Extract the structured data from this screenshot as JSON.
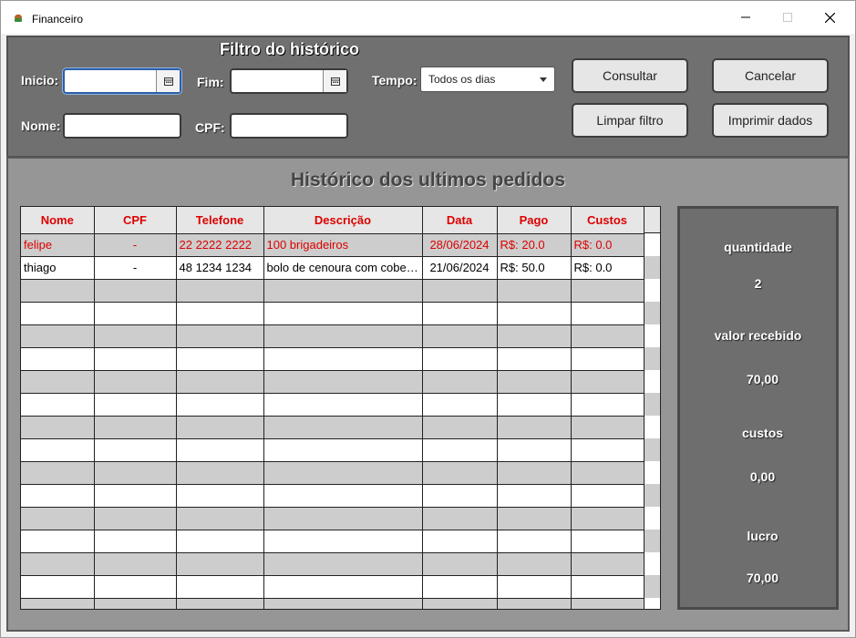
{
  "window": {
    "title": "Financeiro",
    "minimize": "—",
    "maximize": "☐",
    "close": "✕"
  },
  "filter": {
    "title": "Filtro do histórico",
    "inicio_label": "Inicio:",
    "inicio_value": "",
    "fim_label": "Fim:",
    "fim_value": "",
    "tempo_label": "Tempo:",
    "tempo_value": "Todos os dias",
    "nome_label": "Nome:",
    "nome_value": "",
    "cpf_label": "CPF:",
    "cpf_value": "",
    "consultar": "Consultar",
    "cancelar": "Cancelar",
    "limpar": "Limpar filtro",
    "imprimir": "Imprimir dados"
  },
  "history": {
    "title": "Histórico dos ultimos pedidos",
    "columns": [
      "Nome",
      "CPF",
      "Telefone",
      "Descrição",
      "Data",
      "Pago",
      "Custos"
    ],
    "rows": [
      [
        "felipe",
        "-",
        "22 2222 2222",
        "100 brigadeiros",
        "28/06/2024",
        "R$: 20.0",
        "R$: 0.0"
      ],
      [
        "thiago",
        "-",
        "48 1234 1234",
        "bolo de cenoura com cobertura",
        "21/06/2024",
        "R$: 50.0",
        "R$: 0.0"
      ]
    ]
  },
  "summary": {
    "quantidade_label": "quantidade",
    "quantidade_value": "2",
    "recebido_label": "valor recebido",
    "recebido_value": "70,00",
    "custos_label": "custos",
    "custos_value": "0,00",
    "lucro_label": "lucro",
    "lucro_value": "70,00"
  },
  "icons": {
    "calendar": "calendar-icon",
    "dropdown": "chevron-down-icon",
    "app": "app-icon"
  },
  "colors": {
    "header_text": "#dd0000",
    "selected_row_text": "#dd0000",
    "panel": "#707070",
    "main_panel": "#969696"
  }
}
